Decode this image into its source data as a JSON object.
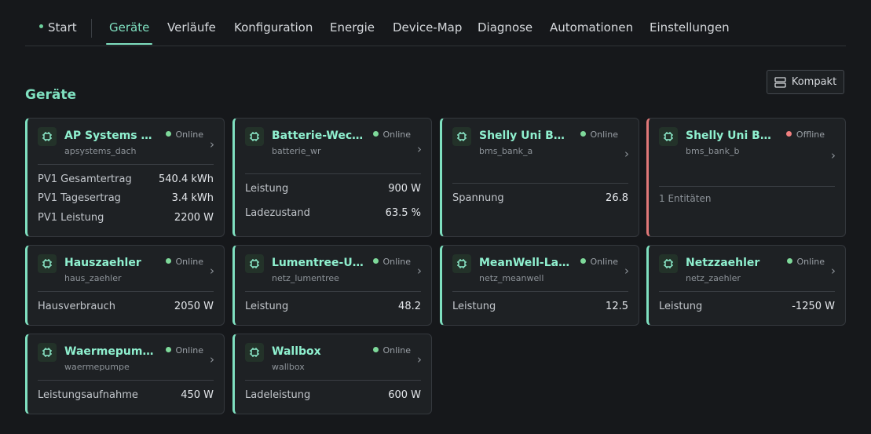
{
  "nav": {
    "items": [
      {
        "label": "Start"
      },
      {
        "label": "Geräte"
      },
      {
        "label": "Verläufe"
      },
      {
        "label": "Konfiguration"
      },
      {
        "label": "Energie"
      },
      {
        "label": "Device-Map"
      },
      {
        "label": "Diagnose"
      },
      {
        "label": "Automationen"
      },
      {
        "label": "Einstellungen"
      }
    ],
    "active": "Geräte"
  },
  "page": {
    "title": "Geräte",
    "compact_label": "Kompakt"
  },
  "colors": {
    "accent": "#7fe0c0",
    "online": "#7ed99a",
    "offline": "#f07f7f",
    "background": "#16181b",
    "card": "#1e2124"
  },
  "devices": [
    {
      "name": "AP Systems EZ...",
      "id": "apsystems_dach",
      "status": "Online",
      "rows": [
        {
          "label": "PV1 Gesamtertrag",
          "value": "540.4 kWh"
        },
        {
          "label": "PV1 Tagesertrag",
          "value": "3.4 kWh"
        },
        {
          "label": "PV1 Leistung",
          "value": "2200 W"
        }
      ]
    },
    {
      "name": "Batterie-Wech...",
      "id": "batterie_wr",
      "status": "Online",
      "rows": [
        {
          "label": "Leistung",
          "value": "900 W"
        },
        {
          "label": "Ladezustand",
          "value": "63.5 %"
        }
      ]
    },
    {
      "name": "Shelly Uni Ban...",
      "id": "bms_bank_a",
      "status": "Online",
      "rows": [
        {
          "label": "Spannung",
          "value": "26.8"
        }
      ]
    },
    {
      "name": "Shelly Uni Ban...",
      "id": "bms_bank_b",
      "status": "Offline",
      "entities": "1 Entitäten"
    },
    {
      "name": "Hauszaehler",
      "id": "haus_zaehler",
      "status": "Online",
      "rows": [
        {
          "label": "Hausverbrauch",
          "value": "2050 W"
        }
      ]
    },
    {
      "name": "Lumentree-U...",
      "id": "netz_lumentree",
      "status": "Online",
      "rows": [
        {
          "label": "Leistung",
          "value": "48.2"
        }
      ]
    },
    {
      "name": "MeanWell-Lad...",
      "id": "netz_meanwell",
      "status": "Online",
      "rows": [
        {
          "label": "Leistung",
          "value": "12.5"
        }
      ]
    },
    {
      "name": "Netzzaehler",
      "id": "netz_zaehler",
      "status": "Online",
      "rows": [
        {
          "label": "Leistung",
          "value": "-1250 W"
        }
      ]
    },
    {
      "name": "Waermepumpe",
      "id": "waermepumpe",
      "status": "Online",
      "rows": [
        {
          "label": "Leistungsaufnahme",
          "value": "450 W"
        }
      ]
    },
    {
      "name": "Wallbox",
      "id": "wallbox",
      "status": "Online",
      "rows": [
        {
          "label": "Ladeleistung",
          "value": "600 W"
        }
      ]
    }
  ]
}
